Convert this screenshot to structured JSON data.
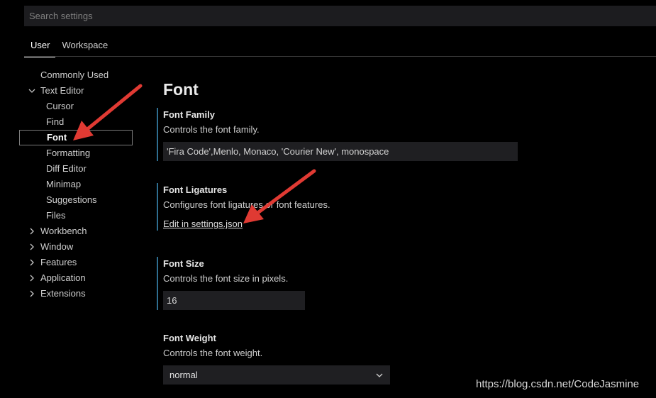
{
  "search": {
    "placeholder": "Search settings"
  },
  "tabs": [
    {
      "label": "User",
      "active": true
    },
    {
      "label": "Workspace",
      "active": false
    }
  ],
  "tree": {
    "commonly_used": "Commonly Used",
    "text_editor": "Text Editor",
    "cursor": "Cursor",
    "find": "Find",
    "font": "Font",
    "formatting": "Formatting",
    "diff_editor": "Diff Editor",
    "minimap": "Minimap",
    "suggestions": "Suggestions",
    "files": "Files",
    "workbench": "Workbench",
    "window": "Window",
    "features": "Features",
    "application": "Application",
    "extensions": "Extensions"
  },
  "section_title": "Font",
  "settings": {
    "font_family": {
      "name": "Font Family",
      "description": "Controls the font family.",
      "value": "'Fira Code',Menlo, Monaco, 'Courier New', monospace"
    },
    "font_ligatures": {
      "name": "Font Ligatures",
      "description": "Configures font ligatures or font features.",
      "link": "Edit in settings.json"
    },
    "font_size": {
      "name": "Font Size",
      "description": "Controls the font size in pixels.",
      "value": "16"
    },
    "font_weight": {
      "name": "Font Weight",
      "description": "Controls the font weight.",
      "value": "normal"
    }
  },
  "annotation_color": "#e03a33",
  "focus_border_color": "#2f6f91",
  "watermark": "https://blog.csdn.net/CodeJasmine"
}
